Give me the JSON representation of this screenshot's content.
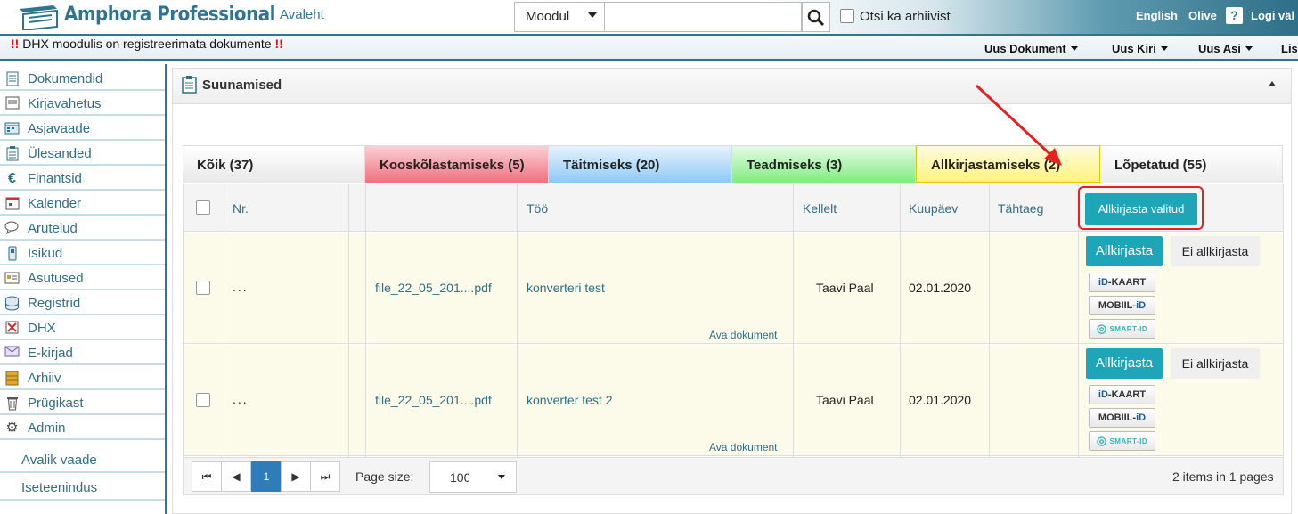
{
  "header": {
    "brand": "Amphora Professional",
    "home_link": "Avaleht",
    "module_select": "Moodul",
    "search_placeholder": "",
    "archive_label": "Otsi ka arhiivist",
    "language": "English",
    "user": "Olive",
    "help": "?",
    "logout": "Logi väl"
  },
  "notice": {
    "mark_left": "!!",
    "text": "DHX moodulis on registreerimata dokumente",
    "mark_right": "!!"
  },
  "top_menu": [
    {
      "label": "Uus Dokument"
    },
    {
      "label": "Uus Kiri"
    },
    {
      "label": "Uus Asi"
    },
    {
      "label": "Lis"
    }
  ],
  "sidebar": {
    "items": [
      {
        "label": "Dokumendid",
        "icon": "document-icon"
      },
      {
        "label": "Kirjavahetus",
        "icon": "letter-icon"
      },
      {
        "label": "Asjavaade",
        "icon": "folder-view-icon"
      },
      {
        "label": "Ülesanded",
        "icon": "clipboard-icon"
      },
      {
        "label": "Finantsid",
        "icon": "euro-icon"
      },
      {
        "label": "Kalender",
        "icon": "calendar-icon"
      },
      {
        "label": "Arutelud",
        "icon": "chat-icon"
      },
      {
        "label": "Isikud",
        "icon": "phone-icon"
      },
      {
        "label": "Asutused",
        "icon": "building-icon"
      },
      {
        "label": "Registrid",
        "icon": "database-icon"
      },
      {
        "label": "DHX",
        "icon": "dhx-icon"
      },
      {
        "label": "E-kirjad",
        "icon": "envelope-icon"
      },
      {
        "label": "Arhiiv",
        "icon": "archive-icon"
      },
      {
        "label": "Prügikast",
        "icon": "trash-icon"
      },
      {
        "label": "Admin",
        "icon": "gear-icon"
      }
    ],
    "plain_items": [
      {
        "label": "Avalik vaade"
      },
      {
        "label": "Iseteenindus"
      }
    ]
  },
  "panel": {
    "title": "Suunamised"
  },
  "tabs": [
    {
      "label": "Kõik (37)"
    },
    {
      "label": "Kooskõlastamiseks (5)"
    },
    {
      "label": "Täitmiseks (20)"
    },
    {
      "label": "Teadmiseks (3)"
    },
    {
      "label": "Allkirjastamiseks (2)"
    },
    {
      "label": "Lõpetatud (55)"
    }
  ],
  "grid": {
    "columns": {
      "nr": "Nr.",
      "too": "Töö",
      "kellelt": "Kellelt",
      "kuupaev": "Kuupäev",
      "tahtaeg": "Tähtaeg"
    },
    "sign_selected": "Allkirjasta valitud",
    "rows": [
      {
        "nr": "...",
        "file": "file_22_05_201....pdf",
        "work": "konverteri test",
        "open_doc": "Ava dokument",
        "from": "Taavi Paal",
        "date": "02.01.2020",
        "deadline": "",
        "sign": "Allkirjasta",
        "nosign": "Ei allkirjasta"
      },
      {
        "nr": "...",
        "file": "file_22_05_201....pdf",
        "work": "konverter test 2",
        "open_doc": "Ava dokument",
        "from": "Taavi Paal",
        "date": "02.01.2020",
        "deadline": "",
        "sign": "Allkirjasta",
        "nosign": "Ei allkirjasta"
      }
    ],
    "badges": {
      "idkaart_a": "iD",
      "idkaart_b": "-KAART",
      "mobiil_a": "MOBIIL-",
      "mobiil_b": "iD",
      "smart": "SMART-ID"
    }
  },
  "pager": {
    "current_page": "1",
    "page_size_label": "Page size:",
    "page_size": "100",
    "info": "2 items in 1 pages"
  },
  "colors": {
    "brand": "#2f7592",
    "sign_button": "#1ea6b8",
    "highlight": "#e82020"
  }
}
